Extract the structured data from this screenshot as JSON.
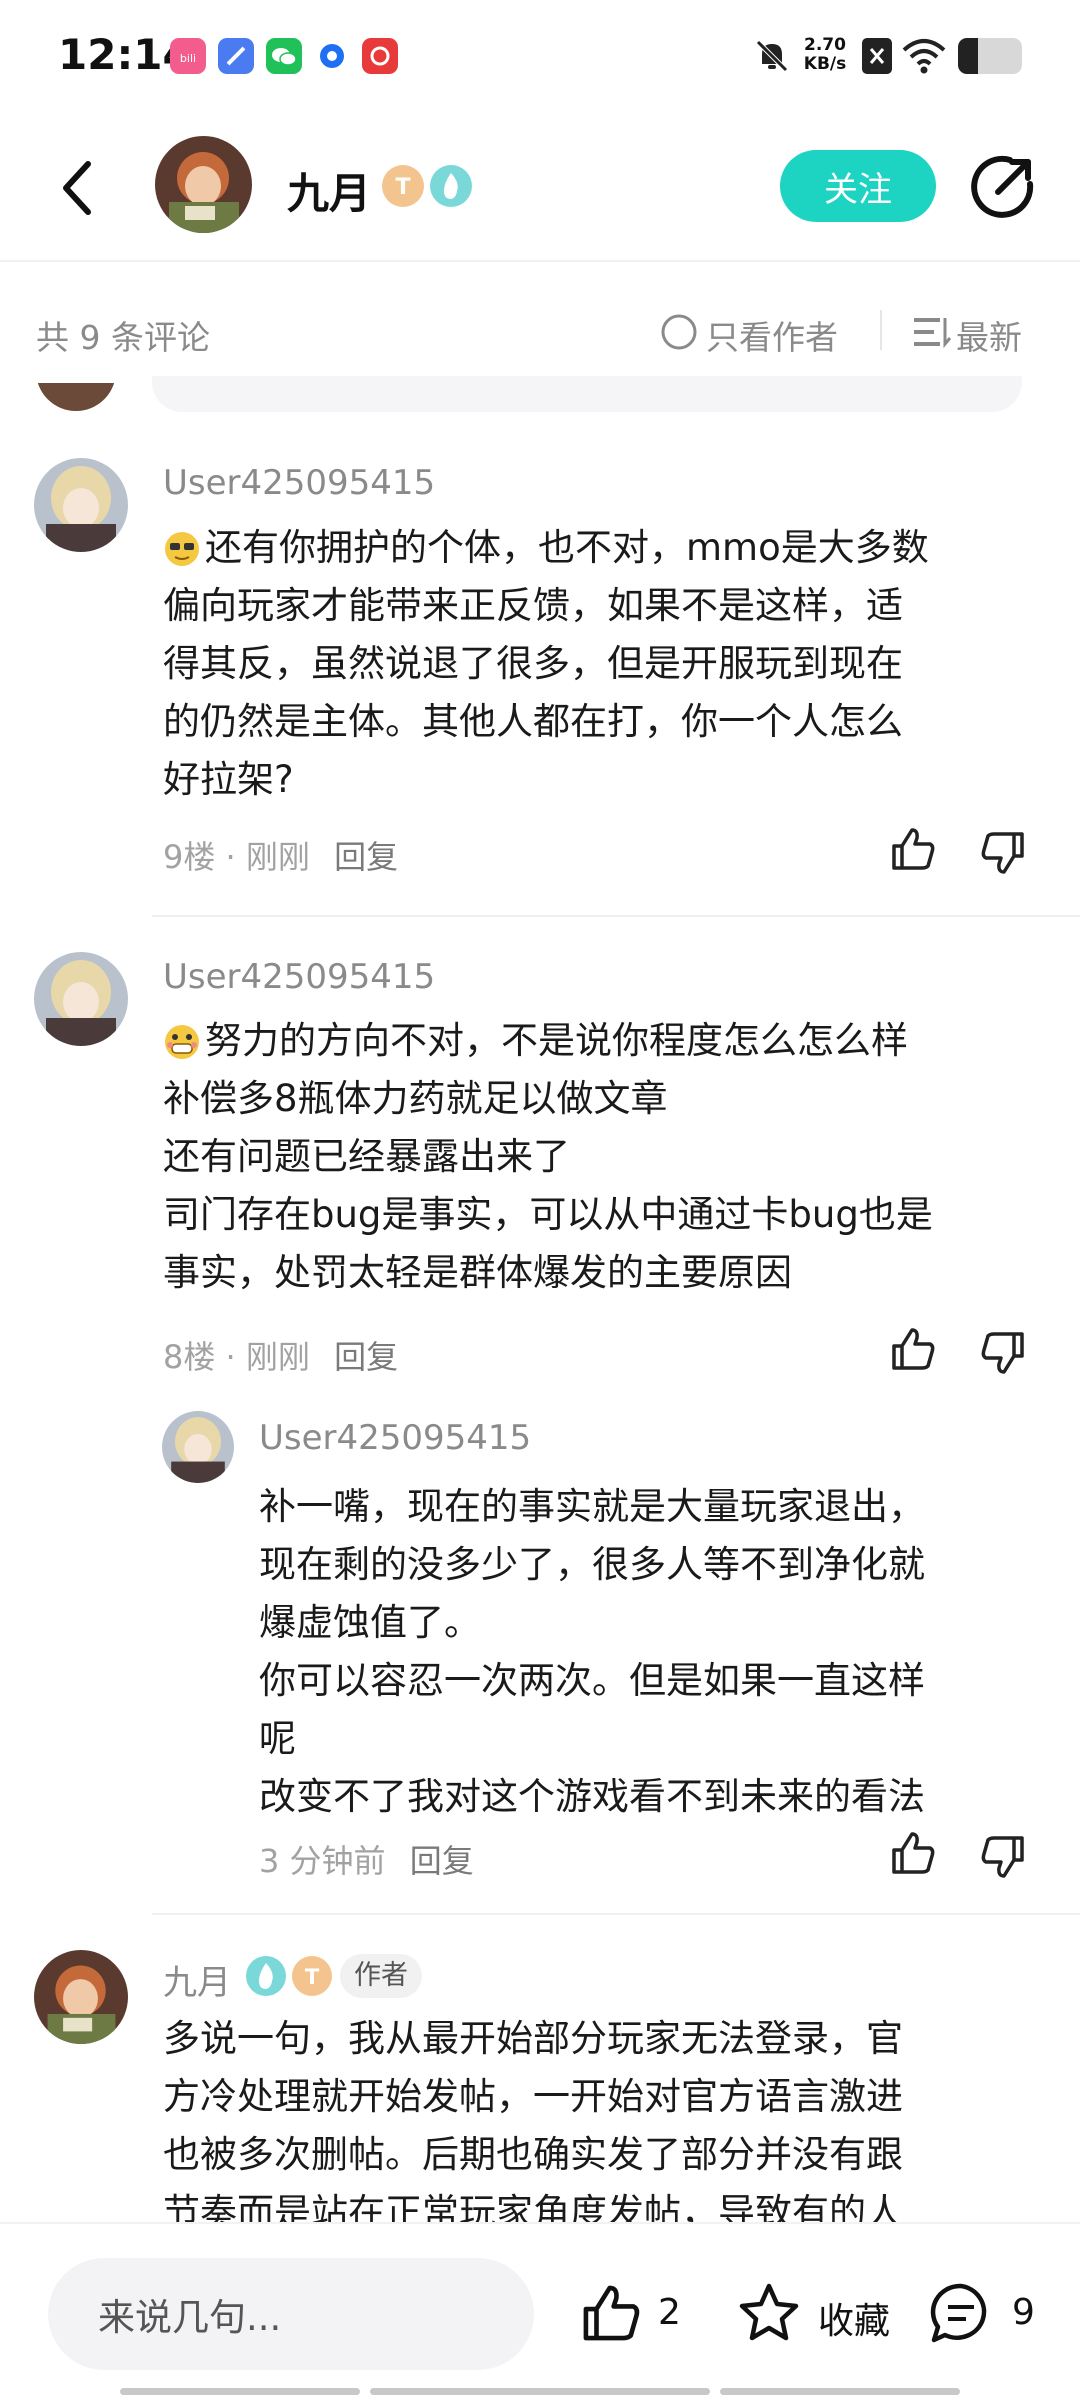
{
  "status_bar": {
    "time": "12:14",
    "net_speed_value": "2.70",
    "net_speed_unit": "KB/s",
    "app_icons": [
      "bilibili-icon",
      "notes-app-icon",
      "wechat-icon",
      "browser-icon",
      "netease-music-icon"
    ],
    "system_icons": [
      "mute-bell-icon",
      "sim-off-icon",
      "wifi-icon",
      "battery-icon"
    ]
  },
  "header": {
    "author_name": "九月",
    "follow_label": "关注",
    "badges": [
      "level-badge",
      "fire-badge"
    ]
  },
  "filter_bar": {
    "count_text": "共 9 条评论",
    "author_only_label": "只看作者",
    "sort_label": "最新"
  },
  "comments": [
    {
      "username": "User425095415",
      "lines": [
        "还有你拥护的个体，也不对，mmo是大多数",
        "偏向玩家才能带来正反馈，如果不是这样，适",
        "得其反，虽然说退了很多，但是开服玩到现在",
        "的仍然是主体。其他人都在打，你一个人怎么",
        "好拉架?"
      ],
      "floor": "9楼",
      "time": "刚刚",
      "reply_label": "回复"
    },
    {
      "username": "User425095415",
      "lines": [
        "努力的方向不对，不是说你程度怎么怎么样",
        "补偿多8瓶体力药就足以做文章",
        "还有问题已经暴露出来了",
        "司门存在bug是事实，可以从中通过卡bug也是",
        "事实，处罚太轻是群体爆发的主要原因"
      ],
      "floor": "8楼",
      "time": "刚刚",
      "reply_label": "回复",
      "sub_reply": {
        "username": "User425095415",
        "lines": [
          "补一嘴，现在的事实就是大量玩家退出，",
          "现在剩的没多少了，很多人等不到净化就",
          "爆虚蚀值了。",
          "你可以容忍一次两次。但是如果一直这样",
          "呢",
          "改变不了我对这个游戏看不到未来的看法"
        ],
        "time": "3 分钟前",
        "reply_label": "回复"
      }
    },
    {
      "username": "九月",
      "author_tag": "作者",
      "lines": [
        "多说一句，我从最开始部分玩家无法登录，官",
        "方冷处理就开始发帖，一开始对官方语言激进",
        "也被多次删帖。后期也确实发了部分并没有跟",
        "节奏而是站在正常玩家角度发帖，导致有的人"
      ]
    }
  ],
  "bottom_bar": {
    "input_placeholder": "来说几句...",
    "like_count": "2",
    "favorite_label": "收藏",
    "comment_count": "9"
  },
  "colors": {
    "accent": "#1dd3c2",
    "meta_text": "#a2a2a2",
    "username_text": "#8a8a8a"
  }
}
